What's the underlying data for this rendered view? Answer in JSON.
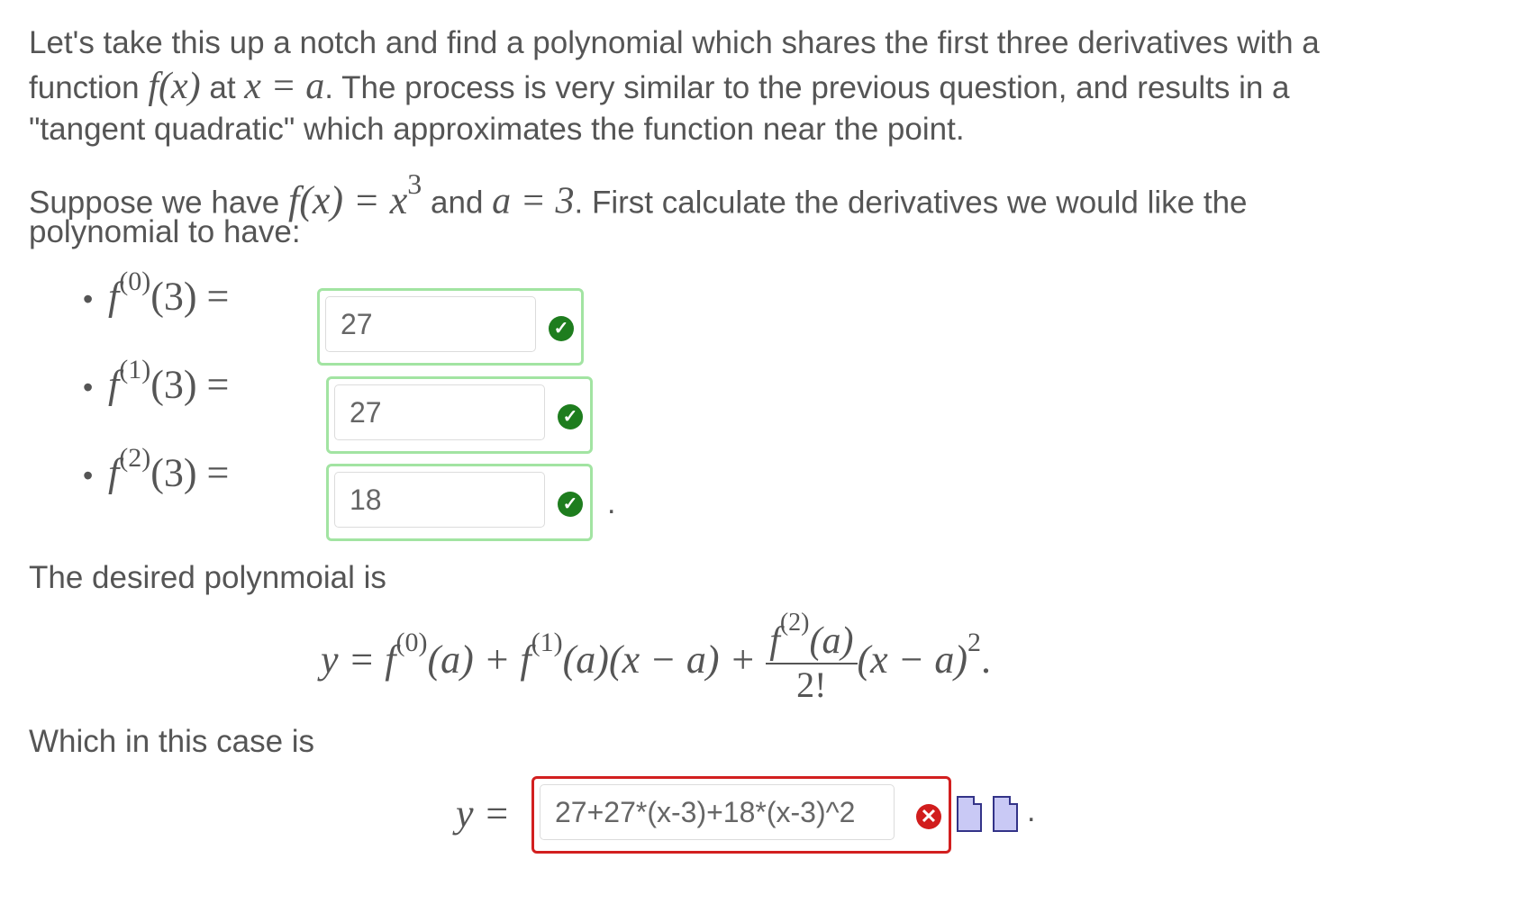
{
  "intro": {
    "line1": "Let's take this up a notch and find a polynomial which shares the first three derivatives with a",
    "line2a": "function",
    "fx": "f(x)",
    "line2b": "at",
    "xeqa": "x = a",
    "line2c": ". The process is very similar to the previous question, and results in a",
    "line3": "\"tangent quadratic\" which approximates the function near the point."
  },
  "suppose": {
    "text_a": "Suppose we have",
    "fx_eq": "f(x) = x",
    "exp": "3",
    "text_b": "and",
    "a_eq": "a = 3",
    "text_c": ". First calculate the derivatives we would like the",
    "line2": "polynomial to have:"
  },
  "derivatives": [
    {
      "bullet": "•",
      "order": "(0)",
      "arg": "(3) =",
      "value": "27",
      "status": "correct"
    },
    {
      "bullet": "•",
      "order": "(1)",
      "arg": "(3) =",
      "value": "27",
      "status": "correct"
    },
    {
      "bullet": "•",
      "order": "(2)",
      "arg": "(3) =",
      "value": "18",
      "status": "correct"
    }
  ],
  "desired": {
    "text": "The desired polynmoial is",
    "formula": {
      "part1": "y = f",
      "sup0": "(0)",
      "part2": "(a) + f",
      "sup1": "(1)",
      "part3": "(a)(x − a) +",
      "num_f": "f",
      "num_sup": "(2)",
      "num_arg": "(a)",
      "den": "2!",
      "part4": "(x − a)",
      "sup_sq": "2",
      "end": "."
    }
  },
  "which": {
    "text": "Which in this case is",
    "lhs": "y =",
    "answer": "27+27*(x-3)+18*(x-3)^2",
    "status": "incorrect",
    "end": "."
  },
  "icons": {
    "check": "✓",
    "cross": "✕",
    "preview": "preview-document-icon",
    "equation": "equation-editor-icon"
  },
  "colors": {
    "correct_border": "#a2e4a2",
    "incorrect_border": "#d21f1f",
    "check_fill": "#1e7d1e",
    "cross_fill": "#d11d1d"
  }
}
